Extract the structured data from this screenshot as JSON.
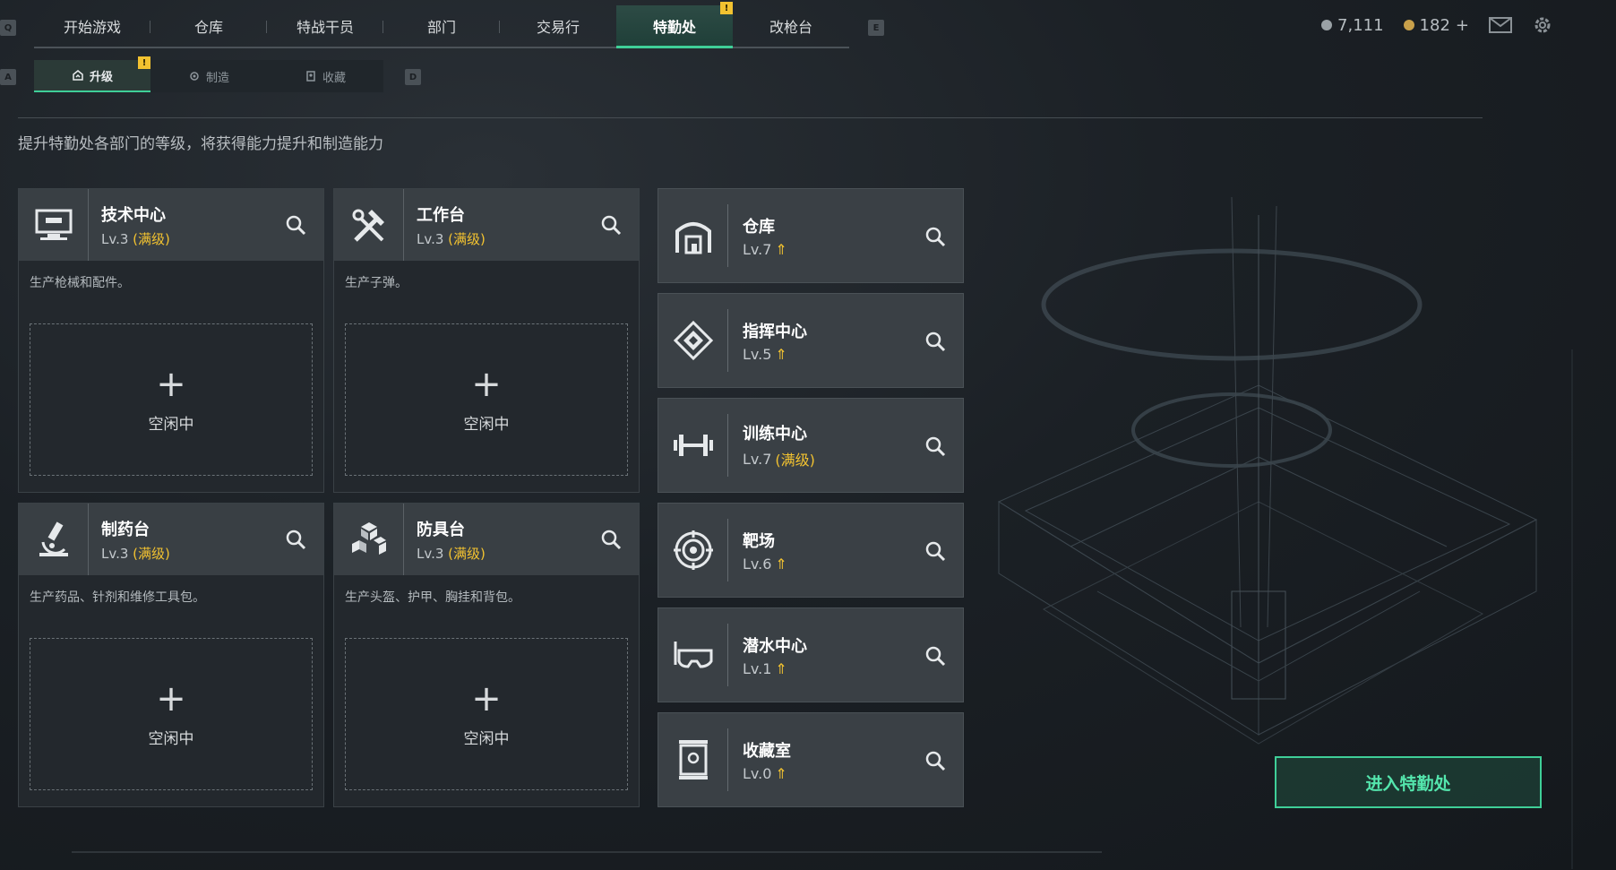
{
  "keys": {
    "left_top": "Q",
    "right_top": "E",
    "left_sub": "A",
    "right_sub": "D"
  },
  "topnav": {
    "tabs": [
      {
        "label": "开始游戏"
      },
      {
        "label": "仓库"
      },
      {
        "label": "特战干员"
      },
      {
        "label": "部门"
      },
      {
        "label": "交易行"
      },
      {
        "label": "特勤处",
        "active": true
      },
      {
        "label": "改枪台"
      }
    ],
    "active_badge": "!"
  },
  "subnav": {
    "tabs": [
      {
        "label": "升级",
        "icon": "upgrade-icon"
      },
      {
        "label": "制造",
        "icon": "craft-icon"
      },
      {
        "label": "收藏",
        "icon": "collection-icon"
      }
    ],
    "active_badge": "!"
  },
  "currency": {
    "silver": "7,111",
    "gold": "182",
    "gold_plus": "+"
  },
  "description": "提升特勤处各部门的等级，将获得能力提升和制造能力",
  "production_cards": [
    {
      "name": "技术中心",
      "level": "Lv.3",
      "max": "(满级)",
      "desc": "生产枪械和配件。",
      "slot_status": "空闲中",
      "icon": "computer-icon"
    },
    {
      "name": "工作台",
      "level": "Lv.3",
      "max": "(满级)",
      "desc": "生产子弹。",
      "slot_status": "空闲中",
      "icon": "tools-icon"
    },
    {
      "name": "制药台",
      "level": "Lv.3",
      "max": "(满级)",
      "desc": "生产药品、针剂和维修工具包。",
      "slot_status": "空闲中",
      "icon": "microscope-icon"
    },
    {
      "name": "防具台",
      "level": "Lv.3",
      "max": "(满级)",
      "desc": "生产头盔、护甲、胸挂和背包。",
      "slot_status": "空闲中",
      "icon": "cubes-icon"
    }
  ],
  "facilities": [
    {
      "name": "仓库",
      "level": "Lv.7",
      "max": "",
      "upgradable": true,
      "icon": "warehouse-icon"
    },
    {
      "name": "指挥中心",
      "level": "Lv.5",
      "max": "",
      "upgradable": true,
      "icon": "command-icon"
    },
    {
      "name": "训练中心",
      "level": "Lv.7",
      "max": "(满级)",
      "upgradable": false,
      "icon": "dumbbell-icon"
    },
    {
      "name": "靶场",
      "level": "Lv.6",
      "max": "",
      "upgradable": true,
      "icon": "target-icon"
    },
    {
      "name": "潜水中心",
      "level": "Lv.1",
      "max": "",
      "upgradable": true,
      "icon": "diving-mask-icon"
    },
    {
      "name": "收藏室",
      "level": "Lv.0",
      "max": "",
      "upgradable": true,
      "icon": "trophy-case-icon"
    }
  ],
  "enter_button": "进入特勤处",
  "colors": {
    "accent": "#3fcf98",
    "max_level": "#f2c230",
    "badge": "#f2c230"
  }
}
